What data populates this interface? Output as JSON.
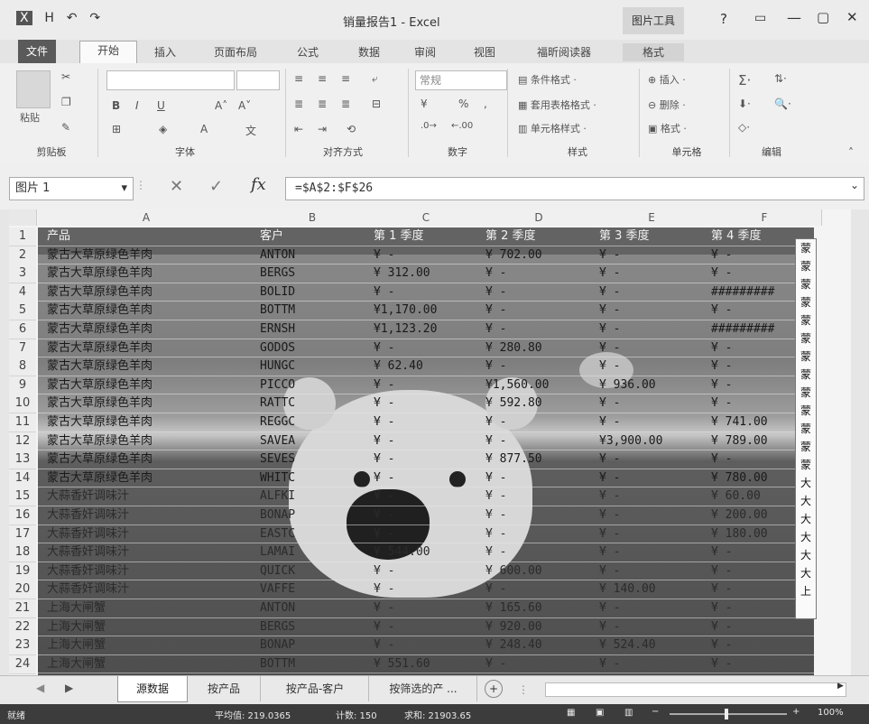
{
  "window": {
    "title": "销量报告1 - Excel",
    "context_tab_group": "图片工具",
    "help": "?",
    "controls": [
      "?",
      "▭",
      "—",
      "▢",
      "✕"
    ]
  },
  "qat": {
    "save": "H",
    "undo": "↶",
    "redo": "↷"
  },
  "tabs": [
    "文件",
    "开始",
    "插入",
    "页面布局",
    "公式",
    "数据",
    "审阅",
    "视图",
    "福昕阅读器",
    "格式"
  ],
  "ribbon": {
    "groups": [
      "剪贴板",
      "字体",
      "对齐方式",
      "数字",
      "样式",
      "单元格",
      "编辑"
    ],
    "paste_label": "粘贴",
    "number_format": "常规",
    "percent": "%",
    "styles": [
      "条件格式 ·",
      "套用表格格式 ·",
      "单元格样式 ·"
    ],
    "cells": [
      "插入 ·",
      "删除 ·",
      "格式 ·"
    ]
  },
  "formula_bar": {
    "name_box": "图片 1",
    "formula": "=$A$2:$F$26",
    "fx": "fx"
  },
  "columns": [
    "A",
    "B",
    "C",
    "D",
    "E",
    "F"
  ],
  "header_row": {
    "product": "产品",
    "customer": "客户",
    "q1": "第 1 季度",
    "q2": "第 2 季度",
    "q3": "第 3 季度",
    "q4": "第 4 季度"
  },
  "rows": [
    {
      "n": "1"
    },
    {
      "n": "2",
      "a": "蒙古大草原绿色羊肉",
      "b": "ANTON",
      "c": "¥      -",
      "d": "¥   702.00",
      "e": "¥      -",
      "f": "¥      -"
    },
    {
      "n": "3",
      "a": "蒙古大草原绿色羊肉",
      "b": "BERGS",
      "c": "¥   312.00",
      "d": "¥      -",
      "e": "¥      -",
      "f": "¥      -"
    },
    {
      "n": "4",
      "a": "蒙古大草原绿色羊肉",
      "b": "BOLID",
      "c": "¥      -",
      "d": "¥      -",
      "e": "¥      -",
      "f": "#########"
    },
    {
      "n": "5",
      "a": "蒙古大草原绿色羊肉",
      "b": "BOTTM",
      "c": "¥1,170.00",
      "d": "¥      -",
      "e": "¥      -",
      "f": "¥      -"
    },
    {
      "n": "6",
      "a": "蒙古大草原绿色羊肉",
      "b": "ERNSH",
      "c": "¥1,123.20",
      "d": "¥      -",
      "e": "¥      -",
      "f": "#########"
    },
    {
      "n": "7",
      "a": "蒙古大草原绿色羊肉",
      "b": "GODOS",
      "c": "¥      -",
      "d": "¥   280.80",
      "e": "¥      -",
      "f": "¥      -"
    },
    {
      "n": "8",
      "a": "蒙古大草原绿色羊肉",
      "b": "HUNGC",
      "c": "¥    62.40",
      "d": "¥      -",
      "e": "¥      -",
      "f": "¥      -"
    },
    {
      "n": "9",
      "a": "蒙古大草原绿色羊肉",
      "b": "PICCO",
      "c": "¥      -",
      "d": "¥1,560.00",
      "e": "¥   936.00",
      "f": "¥      -"
    },
    {
      "n": "10",
      "a": "蒙古大草原绿色羊肉",
      "b": "RATTC",
      "c": "¥      -",
      "d": "¥   592.80",
      "e": "¥      -",
      "f": "¥      -"
    },
    {
      "n": "11",
      "a": "蒙古大草原绿色羊肉",
      "b": "REGGC",
      "c": "¥      -",
      "d": "¥      -",
      "e": "¥      -",
      "f": "¥   741.00"
    },
    {
      "n": "12",
      "a": "蒙古大草原绿色羊肉",
      "b": "SAVEA",
      "c": "¥      -",
      "d": "¥      -",
      "e": "¥3,900.00",
      "f": "¥   789.00"
    },
    {
      "n": "13",
      "a": "蒙古大草原绿色羊肉",
      "b": "SEVES",
      "c": "¥      -",
      "d": "¥   877.50",
      "e": "¥      -",
      "f": "¥      -"
    },
    {
      "n": "14",
      "a": "蒙古大草原绿色羊肉",
      "b": "WHITC",
      "c": "¥      -",
      "d": "¥      -",
      "e": "¥      -",
      "f": "¥   780.00"
    },
    {
      "n": "15",
      "a": "大蒜香奸调味汁",
      "b": "ALFKI",
      "c": "¥      -",
      "d": "¥      -",
      "e": "¥      -",
      "f": "¥    60.00"
    },
    {
      "n": "16",
      "a": "大蒜香奸调味汁",
      "b": "BONAP",
      "c": "¥      -",
      "d": "¥      -",
      "e": "¥      -",
      "f": "¥   200.00"
    },
    {
      "n": "17",
      "a": "大蒜香奸调味汁",
      "b": "EASTC",
      "c": "¥      -",
      "d": "¥      -",
      "e": "¥      -",
      "f": "¥   180.00"
    },
    {
      "n": "18",
      "a": "大蒜香奸调味汁",
      "b": "LAMAI",
      "c": "¥   544.00",
      "d": "¥      -",
      "e": "¥      -",
      "f": "¥      -"
    },
    {
      "n": "19",
      "a": "大蒜香奸调味汁",
      "b": "QUICK",
      "c": "¥      -",
      "d": "¥   600.00",
      "e": "¥      -",
      "f": "¥      -"
    },
    {
      "n": "20",
      "a": "大蒜香奸调味汁",
      "b": "VAFFE",
      "c": "¥      -",
      "d": "¥      -",
      "e": "¥   140.00",
      "f": "¥      -"
    },
    {
      "n": "21",
      "a": "上海大闸蟹",
      "b": "ANTON",
      "c": "¥      -",
      "d": "¥   165.60",
      "e": "¥      -",
      "f": "¥      -"
    },
    {
      "n": "22",
      "a": "上海大闸蟹",
      "b": "BERGS",
      "c": "¥      -",
      "d": "¥   920.00",
      "e": "¥      -",
      "f": "¥      -"
    },
    {
      "n": "23",
      "a": "上海大闸蟹",
      "b": "BONAP",
      "c": "¥      -",
      "d": "¥   248.40",
      "e": "¥   524.40",
      "f": "¥      -"
    },
    {
      "n": "24",
      "a": "上海大闸蟹",
      "b": "BOTTM",
      "c": "¥   551.60",
      "d": "¥      -",
      "e": "¥      -",
      "f": "¥      -"
    }
  ],
  "right_column_chars": [
    "蒙",
    "蒙",
    "蒙",
    "蒙",
    "蒙",
    "蒙",
    "蒙",
    "蒙",
    "蒙",
    "蒙",
    "蒙",
    "蒙",
    "蒙",
    "大",
    "大",
    "大",
    "大",
    "大",
    "大",
    "上"
  ],
  "sheet_tabs": [
    "源数据",
    "按产品",
    "按产品-客户",
    "按筛选的产 ..."
  ],
  "status": {
    "ready": "就绪",
    "average": "平均值: 219.0365",
    "count": "计数: 150",
    "sum": "求和: 21903.65",
    "zoom": "100%"
  }
}
